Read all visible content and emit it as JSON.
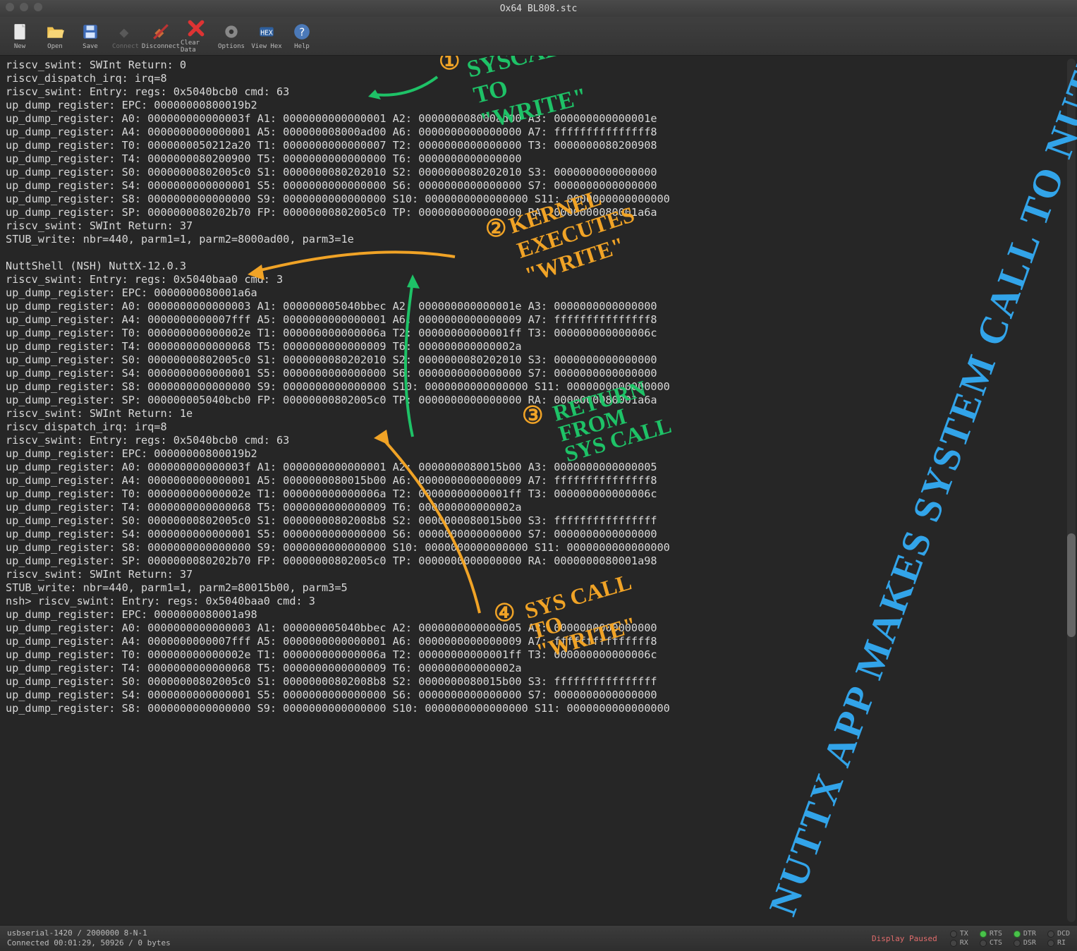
{
  "window": {
    "title": "Ox64 BL808.stc"
  },
  "toolbar": [
    {
      "id": "new",
      "label": "New"
    },
    {
      "id": "open",
      "label": "Open"
    },
    {
      "id": "save",
      "label": "Save"
    },
    {
      "id": "connect",
      "label": "Connect"
    },
    {
      "id": "disconnect",
      "label": "Disconnect"
    },
    {
      "id": "clear",
      "label": "Clear Data"
    },
    {
      "id": "options",
      "label": "Options"
    },
    {
      "id": "viewhex",
      "label": "View Hex"
    },
    {
      "id": "help",
      "label": "Help"
    }
  ],
  "status": {
    "line1": "usbserial-1420 / 2000000 8-N-1",
    "line2": "Connected 00:01:29, 50926 / 0 bytes",
    "display_paused": "Display Paused",
    "leds": [
      {
        "name": "TX",
        "on": false
      },
      {
        "name": "RTS",
        "on": true
      },
      {
        "name": "DTR",
        "on": true
      },
      {
        "name": "DCD",
        "on": false
      },
      {
        "name": "RX",
        "on": false
      },
      {
        "name": "CTS",
        "on": false
      },
      {
        "name": "DSR",
        "on": false
      },
      {
        "name": "RI",
        "on": false
      }
    ]
  },
  "terminal_lines": [
    "riscv_swint: SWInt Return: 0",
    "riscv_dispatch_irq: irq=8",
    "riscv_swint: Entry: regs: 0x5040bcb0 cmd: 63",
    "up_dump_register: EPC: 00000000800019b2",
    "up_dump_register: A0: 000000000000003f A1: 0000000000000001 A2: 000000008000ad00 A3: 000000000000001e",
    "up_dump_register: A4: 0000000000000001 A5: 000000008000ad00 A6: 0000000000000000 A7: fffffffffffffff8",
    "up_dump_register: T0: 0000000050212a20 T1: 0000000000000007 T2: 0000000000000000 T3: 0000000080200908",
    "up_dump_register: T4: 0000000080200900 T5: 0000000000000000 T6: 0000000000000000",
    "up_dump_register: S0: 00000000802005c0 S1: 0000000080202010 S2: 0000000080202010 S3: 0000000000000000",
    "up_dump_register: S4: 0000000000000001 S5: 0000000000000000 S6: 0000000000000000 S7: 0000000000000000",
    "up_dump_register: S8: 0000000000000000 S9: 0000000000000000 S10: 0000000000000000 S11: 0000000000000000",
    "up_dump_register: SP: 0000000080202b70 FP: 00000000802005c0 TP: 0000000000000000 RA: 0000000080001a6a",
    "riscv_swint: SWInt Return: 37",
    "STUB_write: nbr=440, parm1=1, parm2=8000ad00, parm3=1e",
    "",
    "NuttShell (NSH) NuttX-12.0.3",
    "riscv_swint: Entry: regs: 0x5040baa0 cmd: 3",
    "up_dump_register: EPC: 0000000080001a6a",
    "up_dump_register: A0: 0000000000000003 A1: 000000005040bbec A2: 000000000000001e A3: 0000000000000000",
    "up_dump_register: A4: 0000000000007fff A5: 0000000000000001 A6: 0000000000000009 A7: fffffffffffffff8",
    "up_dump_register: T0: 000000000000002e T1: 000000000000006a T2: 00000000000001ff T3: 000000000000006c",
    "up_dump_register: T4: 0000000000000068 T5: 0000000000000009 T6: 000000000000002a",
    "up_dump_register: S0: 00000000802005c0 S1: 0000000080202010 S2: 0000000080202010 S3: 0000000000000000",
    "up_dump_register: S4: 0000000000000001 S5: 0000000000000000 S6: 0000000000000000 S7: 0000000000000000",
    "up_dump_register: S8: 0000000000000000 S9: 0000000000000000 S10: 0000000000000000 S11: 0000000000000000",
    "up_dump_register: SP: 000000005040bcb0 FP: 00000000802005c0 TP: 0000000000000000 RA: 0000000080001a6a",
    "riscv_swint: SWInt Return: 1e",
    "riscv_dispatch_irq: irq=8",
    "riscv_swint: Entry: regs: 0x5040bcb0 cmd: 63",
    "up_dump_register: EPC: 00000000800019b2",
    "up_dump_register: A0: 000000000000003f A1: 0000000000000001 A2: 0000000080015b00 A3: 0000000000000005",
    "up_dump_register: A4: 0000000000000001 A5: 0000000080015b00 A6: 0000000000000009 A7: fffffffffffffff8",
    "up_dump_register: T0: 000000000000002e T1: 000000000000006a T2: 00000000000001ff T3: 000000000000006c",
    "up_dump_register: T4: 0000000000000068 T5: 0000000000000009 T6: 000000000000002a",
    "up_dump_register: S0: 00000000802005c0 S1: 00000000802008b8 S2: 0000000080015b00 S3: ffffffffffffffff",
    "up_dump_register: S4: 0000000000000001 S5: 0000000000000000 S6: 0000000000000000 S7: 0000000000000000",
    "up_dump_register: S8: 0000000000000000 S9: 0000000000000000 S10: 0000000000000000 S11: 0000000000000000",
    "up_dump_register: SP: 0000000080202b70 FP: 00000000802005c0 TP: 0000000000000000 RA: 0000000080001a98",
    "riscv_swint: SWInt Return: 37",
    "STUB_write: nbr=440, parm1=1, parm2=80015b00, parm3=5",
    "nsh> riscv_swint: Entry: regs: 0x5040baa0 cmd: 3",
    "up_dump_register: EPC: 0000000080001a98",
    "up_dump_register: A0: 0000000000000003 A1: 000000005040bbec A2: 0000000000000005 A3: 0000000000000000",
    "up_dump_register: A4: 0000000000007fff A5: 0000000000000001 A6: 0000000000000009 A7: fffffffffffffff8",
    "up_dump_register: T0: 000000000000002e T1: 000000000000006a T2: 00000000000001ff T3: 000000000000006c",
    "up_dump_register: T4: 0000000000000068 T5: 0000000000000009 T6: 000000000000002a",
    "up_dump_register: S0: 00000000802005c0 S1: 00000000802008b8 S2: 0000000080015b00 S3: ffffffffffffffff",
    "up_dump_register: S4: 0000000000000001 S5: 0000000000000000 S6: 0000000000000000 S7: 0000000000000000",
    "up_dump_register: S8: 0000000000000000 S9: 0000000000000000 S10: 0000000000000000 S11: 0000000000000000"
  ],
  "annotations": {
    "a1_circle": "①",
    "a1_text": "SYSCALL\nTO\n\"WRITE\"",
    "a2_circle": "②",
    "a2_text": "KERNEL\nEXECUTES\n\"WRITE\"",
    "a3_circle": "③",
    "a3_text": "RETURN\nFROM\nSYS CALL",
    "a4_circle": "④",
    "a4_text": "SYS CALL\nTO\n\"WRITE\"",
    "big": "NUTTX APP MAKES SYSTEM CALL TO NUTTX KERNEL"
  }
}
